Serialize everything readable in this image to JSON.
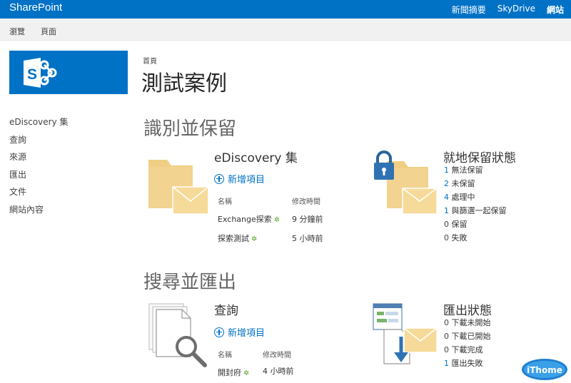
{
  "suitebar": {
    "brand": "SharePoint",
    "links": [
      "新聞摘要",
      "SkyDrive",
      "網站"
    ]
  },
  "ribbon": {
    "tabs": [
      "瀏覽",
      "頁面"
    ]
  },
  "leftnav": {
    "items": [
      "eDiscovery 集",
      "查詢",
      "來源",
      "匯出",
      "文件",
      "網站內容"
    ]
  },
  "breadcrumb": "首頁",
  "page_title": "測試案例",
  "sections": {
    "hold": {
      "title": "識別並保留",
      "ediscovery": {
        "title": "eDiscovery 集",
        "new_item": "新增項目",
        "columns": [
          "名稱",
          "修改時間"
        ],
        "rows": [
          {
            "name": "Exchange探索",
            "time": "9 分鐘前"
          },
          {
            "name": "探索測試",
            "time": "5 小時前"
          }
        ]
      },
      "inplace": {
        "title": "就地保留狀態",
        "items": [
          {
            "count": "1",
            "label": "無法保留"
          },
          {
            "count": "2",
            "label": "未保留"
          },
          {
            "count": "4",
            "label": "處理中"
          },
          {
            "count": "1",
            "label": "與篩選一起保留"
          },
          {
            "count": "0",
            "label": "保留"
          },
          {
            "count": "0",
            "label": "失敗"
          }
        ]
      }
    },
    "search": {
      "title": "搜尋並匯出",
      "queries": {
        "title": "查詢",
        "new_item": "新增項目",
        "columns": [
          "名稱",
          "修改時間"
        ],
        "rows": [
          {
            "name": "開封府",
            "time": "4 小時前"
          }
        ]
      },
      "export": {
        "title": "匯出狀態",
        "items": [
          {
            "count": "0",
            "label": "下載未開始"
          },
          {
            "count": "0",
            "label": "下載已開始"
          },
          {
            "count": "0",
            "label": "下載完成"
          },
          {
            "count": "1",
            "label": "匯出失敗"
          }
        ]
      }
    }
  },
  "new_marker": "✲",
  "watermark_text": "iThome",
  "colors": {
    "suitebar": "#0072c6",
    "link": "#0072c6",
    "folder": "#f0cf85",
    "new_mark": "#5aa02c"
  }
}
